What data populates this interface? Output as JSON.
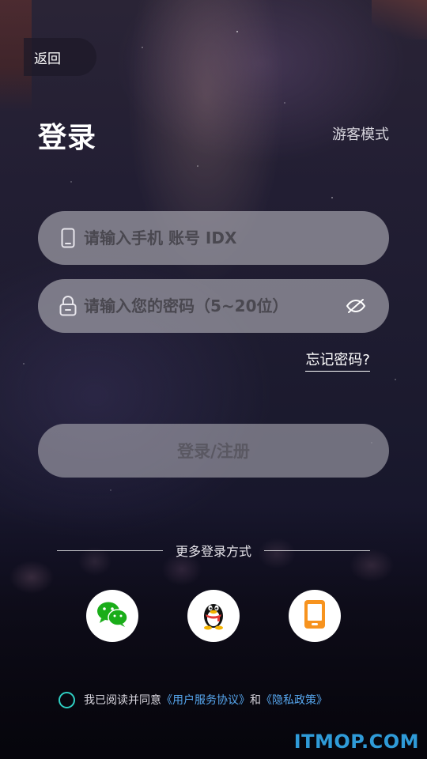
{
  "header": {
    "back_label": "返回",
    "title": "登录",
    "guest_label": "游客模式"
  },
  "form": {
    "account_placeholder": "请输入手机 账号 IDX",
    "account_icon": "phone-outline-icon",
    "password_placeholder": "请输入您的密码（5~20位）",
    "password_icon": "lock-icon",
    "visibility_icon": "eye-off-icon",
    "forgot_label": "忘记密码?",
    "submit_label": "登录/注册"
  },
  "social": {
    "divider_label": "更多登录方式",
    "items": [
      {
        "name": "wechat",
        "icon": "wechat-icon",
        "color": "#1aad19"
      },
      {
        "name": "qq",
        "icon": "qq-penguin-icon",
        "color": "#000000"
      },
      {
        "name": "phone",
        "icon": "mobile-phone-icon",
        "color": "#f7931e"
      }
    ]
  },
  "agreement": {
    "prefix": "我已阅读并同意",
    "user_agreement": "《用户服务协议》",
    "conjunction": "和",
    "privacy_policy": "《隐私政策》",
    "radio_color": "#2fd0c4",
    "link_color": "#57a8f0"
  },
  "watermark": "ITMOP.COM"
}
